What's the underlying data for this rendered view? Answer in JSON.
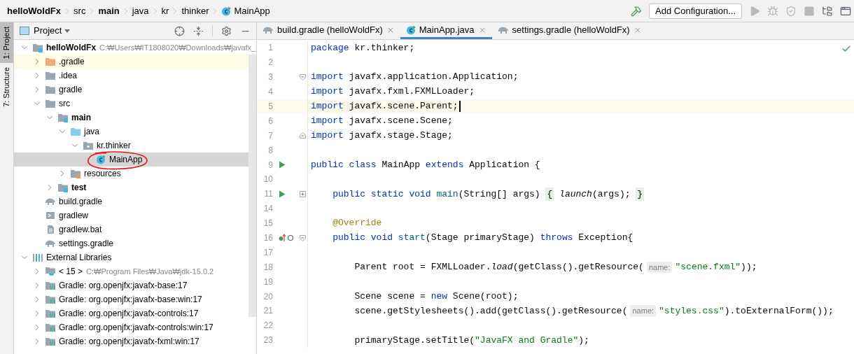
{
  "breadcrumbs": [
    {
      "label": "helloWoldFx",
      "kind": "folder",
      "bold": true
    },
    {
      "label": "src",
      "kind": "folder",
      "bold": false
    },
    {
      "label": "main",
      "kind": "folder",
      "bold": true
    },
    {
      "label": "java",
      "kind": "folder",
      "bold": false
    },
    {
      "label": "kr",
      "kind": "folder",
      "bold": false
    },
    {
      "label": "thinker",
      "kind": "folder",
      "bold": false
    },
    {
      "label": "MainApp",
      "kind": "class",
      "bold": false
    }
  ],
  "toolbar": {
    "configuration_button": "Add Configuration...",
    "actions": [
      {
        "kind": "build",
        "disabled": false
      },
      {
        "kind": "run",
        "disabled": true
      },
      {
        "kind": "debug",
        "disabled": true
      },
      {
        "kind": "coverage",
        "disabled": true
      },
      {
        "kind": "stop",
        "disabled": true
      },
      {
        "kind": "project-structure",
        "disabled": false
      },
      {
        "kind": "window",
        "disabled": false
      }
    ]
  },
  "tool_windows": [
    {
      "label": "1: Project",
      "selected": true
    },
    {
      "label": "7: Structure",
      "selected": false
    }
  ],
  "project_panel": {
    "title": "Project"
  },
  "tree": [
    {
      "label": "helloWoldFx",
      "detail": "C:₩Users₩IT1808020₩Downloads₩javafx_",
      "kind": "module",
      "bold": true,
      "expanded": true,
      "selected": false,
      "children": [
        {
          "label": ".gradle",
          "kind": "excluded-folder",
          "expanded": false,
          "selected": false,
          "highlighted": true
        },
        {
          "label": ".idea",
          "kind": "folder",
          "expanded": false,
          "selected": false
        },
        {
          "label": "gradle",
          "kind": "folder",
          "expanded": false,
          "selected": false
        },
        {
          "label": "src",
          "kind": "folder",
          "expanded": true,
          "selected": false,
          "children": [
            {
              "label": "main",
              "kind": "module-folder",
              "bold": true,
              "expanded": true,
              "selected": false,
              "children": [
                {
                  "label": "java",
                  "kind": "source-folder",
                  "expanded": true,
                  "selected": false,
                  "children": [
                    {
                      "label": "kr.thinker",
                      "kind": "package",
                      "expanded": true,
                      "selected": false,
                      "children": [
                        {
                          "label": "MainApp",
                          "kind": "class",
                          "selected": true,
                          "circled": true
                        }
                      ]
                    }
                  ]
                },
                {
                  "label": "resources",
                  "kind": "resource-folder",
                  "expanded": false,
                  "selected": false
                }
              ]
            },
            {
              "label": "test",
              "kind": "module-folder",
              "bold": true,
              "expanded": false,
              "selected": false
            }
          ]
        },
        {
          "label": "build.gradle",
          "kind": "gradle",
          "selected": false
        },
        {
          "label": "gradlew",
          "kind": "script",
          "selected": false
        },
        {
          "label": "gradlew.bat",
          "kind": "text-file",
          "selected": false
        },
        {
          "label": "settings.gradle",
          "kind": "gradle",
          "selected": false
        }
      ]
    },
    {
      "label": "External Libraries",
      "kind": "libraries",
      "expanded": true,
      "selected": false,
      "children": [
        {
          "label": "< 15 >",
          "detail": "C:₩Program Files₩Java₩jdk-15.0.2",
          "kind": "jdk",
          "expanded": false,
          "selected": false
        },
        {
          "label": "Gradle: org.openjfx:javafx-base:17",
          "kind": "library",
          "expanded": false,
          "selected": false
        },
        {
          "label": "Gradle: org.openjfx:javafx-base:win:17",
          "kind": "library",
          "expanded": false,
          "selected": false
        },
        {
          "label": "Gradle: org.openjfx:javafx-controls:17",
          "kind": "library",
          "expanded": false,
          "selected": false
        },
        {
          "label": "Gradle: org.openjfx:javafx-controls:win:17",
          "kind": "library",
          "expanded": false,
          "selected": false
        },
        {
          "label": "Gradle: org.openjfx:javafx-fxml:win:17",
          "kind": "library",
          "expanded": false,
          "selected": false
        }
      ]
    }
  ],
  "editor_tabs": [
    {
      "label": "build.gradle (helloWoldFx)",
      "kind": "gradle",
      "selected": false
    },
    {
      "label": "MainApp.java",
      "kind": "class",
      "selected": true
    },
    {
      "label": "settings.gradle (helloWoldFx)",
      "kind": "gradle",
      "selected": false
    }
  ],
  "inspection_ok": true,
  "lines": [
    {
      "number": "1",
      "tokens": [
        {
          "kind": "keyword",
          "text": "package"
        },
        {
          "kind": "plain",
          "text": " kr.thinker;"
        }
      ]
    },
    {
      "number": "2"
    },
    {
      "number": "3",
      "fold_start": true,
      "tokens": [
        {
          "kind": "keyword",
          "text": "import"
        },
        {
          "kind": "plain",
          "text": " javafx.application.Application;"
        }
      ]
    },
    {
      "number": "4",
      "tokens": [
        {
          "kind": "keyword",
          "text": "import"
        },
        {
          "kind": "plain",
          "text": " javafx.fxml.FXMLLoader;"
        }
      ]
    },
    {
      "number": "5",
      "current": true,
      "tokens": [
        {
          "kind": "keyword",
          "text": "import"
        },
        {
          "kind": "plain",
          "text": " javafx.scene.Parent;"
        }
      ]
    },
    {
      "number": "6",
      "tokens": [
        {
          "kind": "keyword",
          "text": "import"
        },
        {
          "kind": "plain",
          "text": " javafx.scene.Scene;"
        }
      ]
    },
    {
      "number": "7",
      "fold_end": true,
      "tokens": [
        {
          "kind": "keyword",
          "text": "import"
        },
        {
          "kind": "plain",
          "text": " javafx.stage.Stage;"
        }
      ]
    },
    {
      "number": "8"
    },
    {
      "number": "9",
      "run": true,
      "tokens": [
        {
          "kind": "keyword",
          "text": "public class"
        },
        {
          "kind": "plain",
          "text": " MainApp "
        },
        {
          "kind": "keyword",
          "text": "extends"
        },
        {
          "kind": "plain",
          "text": " Application {"
        }
      ]
    },
    {
      "number": "10"
    },
    {
      "number": "11",
      "run": true,
      "folded": true,
      "tokens": [
        {
          "kind": "keyword",
          "text": "    public static void "
        },
        {
          "kind": "declaration",
          "text": "main"
        },
        {
          "kind": "plain",
          "text": "(String[] args) "
        },
        {
          "kind": "folded",
          "text": "{"
        },
        {
          "kind": "static-call",
          "text": " launch"
        },
        {
          "kind": "plain",
          "text": "(args); "
        },
        {
          "kind": "folded",
          "text": "}"
        }
      ]
    },
    {
      "number": "14"
    },
    {
      "number": "15",
      "tokens": [
        {
          "kind": "annotation",
          "text": "    @Override"
        }
      ]
    },
    {
      "number": "16",
      "override": true,
      "fold_start": true,
      "tokens": [
        {
          "kind": "keyword",
          "text": "    public void "
        },
        {
          "kind": "declaration",
          "text": "start"
        },
        {
          "kind": "plain",
          "text": "(Stage primaryStage) "
        },
        {
          "kind": "keyword",
          "text": "throws"
        },
        {
          "kind": "plain",
          "text": " Exception{"
        }
      ]
    },
    {
      "number": "17"
    },
    {
      "number": "18",
      "tokens": [
        {
          "kind": "plain",
          "text": "        Parent root = FXMLLoader."
        },
        {
          "kind": "static-call",
          "text": "load"
        },
        {
          "kind": "plain",
          "text": "(getClass().getResource("
        },
        {
          "kind": "hint",
          "text": "name:"
        },
        {
          "kind": "string",
          "text": "\"scene.fxml\""
        },
        {
          "kind": "plain",
          "text": "));"
        }
      ]
    },
    {
      "number": "19"
    },
    {
      "number": "20",
      "tokens": [
        {
          "kind": "plain",
          "text": "        Scene scene = "
        },
        {
          "kind": "keyword",
          "text": "new"
        },
        {
          "kind": "plain",
          "text": " Scene(root);"
        }
      ]
    },
    {
      "number": "21",
      "tokens": [
        {
          "kind": "plain",
          "text": "        scene.getStylesheets().add(getClass().getResource("
        },
        {
          "kind": "hint",
          "text": "name:"
        },
        {
          "kind": "string",
          "text": "\"styles.css\""
        },
        {
          "kind": "plain",
          "text": ").toExternalForm());"
        }
      ]
    },
    {
      "number": "22"
    },
    {
      "number": "23",
      "tokens": [
        {
          "kind": "plain",
          "text": "        primaryStage.setTitle("
        },
        {
          "kind": "string",
          "text": "\"JavaFX and Gradle\""
        },
        {
          "kind": "plain",
          "text": ");"
        }
      ]
    }
  ]
}
